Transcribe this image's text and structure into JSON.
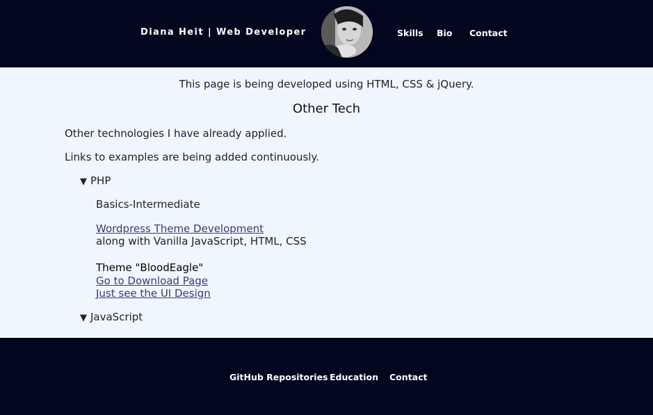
{
  "header": {
    "title": "Diana Heit | Web Developer",
    "nav": {
      "skills": "Skills",
      "bio": "Bio",
      "contact": "Contact"
    }
  },
  "main": {
    "intro": "This page is being developed using HTML, CSS & jQuery.",
    "section_title": "Other Tech",
    "paragraphs": [
      "Other technologies I have already applied.",
      "Links to examples are being added continuously."
    ],
    "details": [
      {
        "marker": "▼",
        "summary": "PHP",
        "level": "Basics-Intermediate",
        "link_wordpress": "Wordpress Theme Development",
        "wordpress_note": "along with Vanilla JavaScript, HTML, CSS",
        "theme_title": "Theme \"BloodEagle\"",
        "link_download": "Go to Download Page",
        "link_ui": "Just see the UI Design"
      },
      {
        "marker": "▼",
        "summary": "JavaScript"
      }
    ]
  },
  "footer": {
    "github": "GitHub Repositories",
    "education": "Education",
    "contact": "Contact"
  },
  "colors": {
    "header_bg": "#02061f",
    "page_bg": "#f0f6fd",
    "link": "#3d3a75"
  }
}
